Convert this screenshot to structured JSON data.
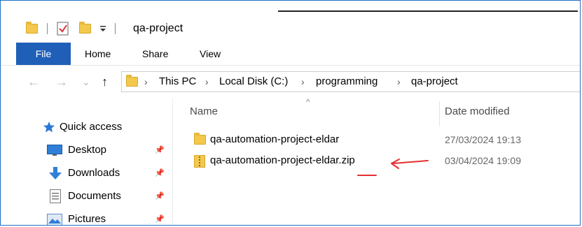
{
  "window": {
    "title": "qa-project"
  },
  "ribbon": {
    "tabs": [
      "File",
      "Home",
      "Share",
      "View"
    ]
  },
  "address": {
    "nav": {
      "back": "←",
      "forward": "→",
      "recent": "⌄",
      "up": "↑"
    },
    "breadcrumb": [
      "This PC",
      "Local Disk (C:)",
      "programming",
      "qa-project"
    ],
    "separator": "›"
  },
  "nav_pane": {
    "items": [
      {
        "label": "Quick access",
        "icon": "star-icon",
        "pinned": false
      },
      {
        "label": "Desktop",
        "icon": "desktop-icon",
        "pinned": true
      },
      {
        "label": "Downloads",
        "icon": "download-arrow-icon",
        "pinned": true
      },
      {
        "label": "Documents",
        "icon": "document-icon",
        "pinned": true
      },
      {
        "label": "Pictures",
        "icon": "pictures-icon",
        "pinned": true
      }
    ]
  },
  "file_list": {
    "columns": {
      "name": "Name",
      "date_modified": "Date modified"
    },
    "sort_indicator": "^",
    "rows": [
      {
        "name": "qa-automation-project-eldar",
        "date_modified": "27/03/2024 19:13",
        "type_icon": "folder-icon"
      },
      {
        "name": "qa-automation-project-eldar.zip",
        "date_modified": "03/04/2024 19:09",
        "type_icon": "zip-folder-icon"
      }
    ]
  },
  "colors": {
    "accent": "#1f5fb8",
    "annotation": "#e53030",
    "folder": "#f3c84c"
  }
}
